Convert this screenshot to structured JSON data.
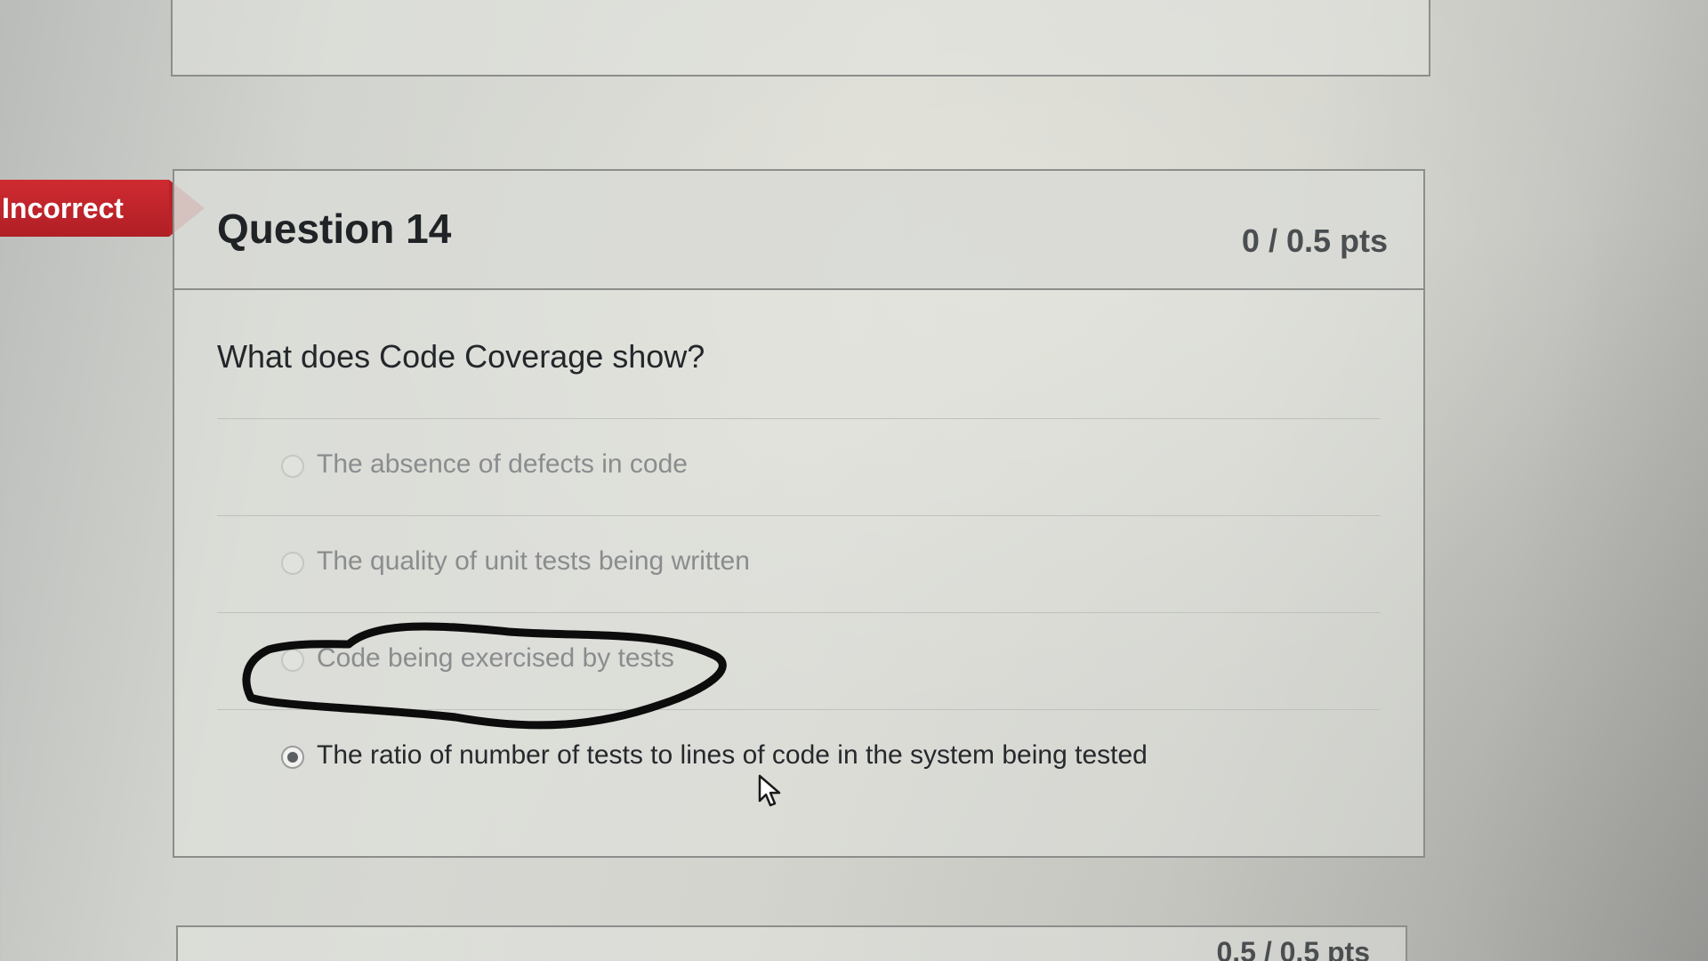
{
  "status_tag": {
    "label": "Incorrect",
    "color": "#c0252c"
  },
  "question": {
    "title": "Question 14",
    "points": "0 / 0.5 pts",
    "text": "What does Code Coverage show?",
    "answers": [
      {
        "label": "The absence of defects in code",
        "selected": false
      },
      {
        "label": "The quality of unit tests being written",
        "selected": false
      },
      {
        "label": "Code being exercised by tests",
        "selected": false,
        "hand_circled": true
      },
      {
        "label": "The ratio of number of tests to lines of code in the system being tested",
        "selected": true
      }
    ]
  },
  "next_question": {
    "points": "0.5 / 0.5 pts"
  },
  "annotation": {
    "type": "hand-drawn-ellipse",
    "color": "#0c0c0c"
  },
  "icons": {
    "cursor": "mouse-pointer-icon"
  }
}
